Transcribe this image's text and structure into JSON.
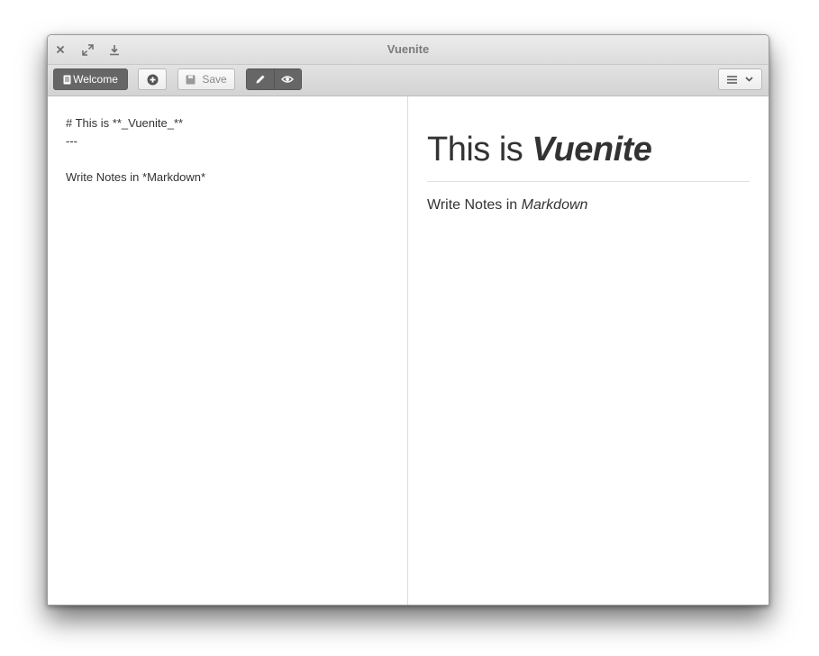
{
  "window": {
    "title": "Vuenite"
  },
  "titlebar": {
    "close_icon": "close-icon",
    "maximize_icon": "maximize-icon",
    "download_icon": "download-icon"
  },
  "toolbar": {
    "welcome_label": "Welcome",
    "new_note_icon": "plus-circle-icon",
    "save_label": "Save",
    "edit_icon": "pencil-icon",
    "preview_icon": "eye-icon",
    "menu_icon": "hamburger-icon",
    "dropdown_icon": "chevron-down-icon"
  },
  "editor": {
    "lines": [
      "# This is **_Vuenite_**",
      "---",
      "",
      "Write Notes in *Markdown*"
    ]
  },
  "preview": {
    "heading_prefix": "This is ",
    "heading_emphasis": "Vuenite",
    "paragraph_prefix": "Write Notes in ",
    "paragraph_emphasis": "Markdown"
  },
  "colors": {
    "active_button": "#666666",
    "toolbar_bg": "#d9d9d9",
    "text": "#333333"
  }
}
